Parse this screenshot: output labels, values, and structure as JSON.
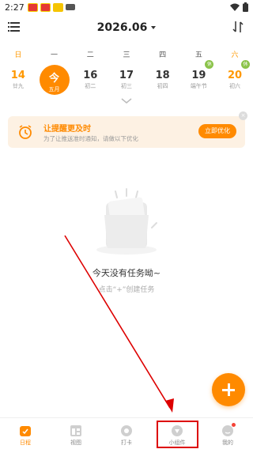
{
  "status_bar": {
    "time": "2:27",
    "notification_icons": [
      "app-notification-icon",
      "app-notification-icon",
      "app-notification-icon",
      "media-icon"
    ],
    "right_icons": [
      "wifi-icon",
      "battery-icon"
    ]
  },
  "header": {
    "month": "2026.06",
    "menu_icon": "menu-icon",
    "sort_icon": "sort-icon"
  },
  "weekdays": [
    "日",
    "一",
    "二",
    "三",
    "四",
    "五",
    "六"
  ],
  "dates": [
    {
      "day": "14",
      "lunar": "廿九",
      "weekend": true,
      "today": false,
      "badge": ""
    },
    {
      "day": "今",
      "lunar": "五月",
      "weekend": false,
      "today": true,
      "badge": ""
    },
    {
      "day": "16",
      "lunar": "初二",
      "weekend": false,
      "today": false,
      "badge": ""
    },
    {
      "day": "17",
      "lunar": "初三",
      "weekend": false,
      "today": false,
      "badge": ""
    },
    {
      "day": "18",
      "lunar": "初四",
      "weekend": false,
      "today": false,
      "badge": ""
    },
    {
      "day": "19",
      "lunar": "端午节",
      "weekend": false,
      "today": false,
      "badge": "休"
    },
    {
      "day": "20",
      "lunar": "初六",
      "weekend": true,
      "today": false,
      "badge": "休"
    }
  ],
  "reminder": {
    "title": "让提醒更及时",
    "description": "为了让推送准时通知，请做以下优化",
    "action_label": "立即优化",
    "close_symbol": "×"
  },
  "empty_state": {
    "title": "今天没有任务呦~",
    "hint": "点击“+”创建任务"
  },
  "bottom_nav": [
    {
      "label": "日程",
      "icon": "calendar-icon",
      "active": true
    },
    {
      "label": "视图",
      "icon": "view-grid-icon",
      "active": false
    },
    {
      "label": "打卡",
      "icon": "check-in-icon",
      "active": false
    },
    {
      "label": "小组件",
      "icon": "widget-icon",
      "active": false
    },
    {
      "label": "我的",
      "icon": "profile-icon",
      "active": false
    }
  ],
  "colors": {
    "accent": "#ff8a00",
    "annotation": "#d00000",
    "holiday_badge": "#8bc34a"
  }
}
